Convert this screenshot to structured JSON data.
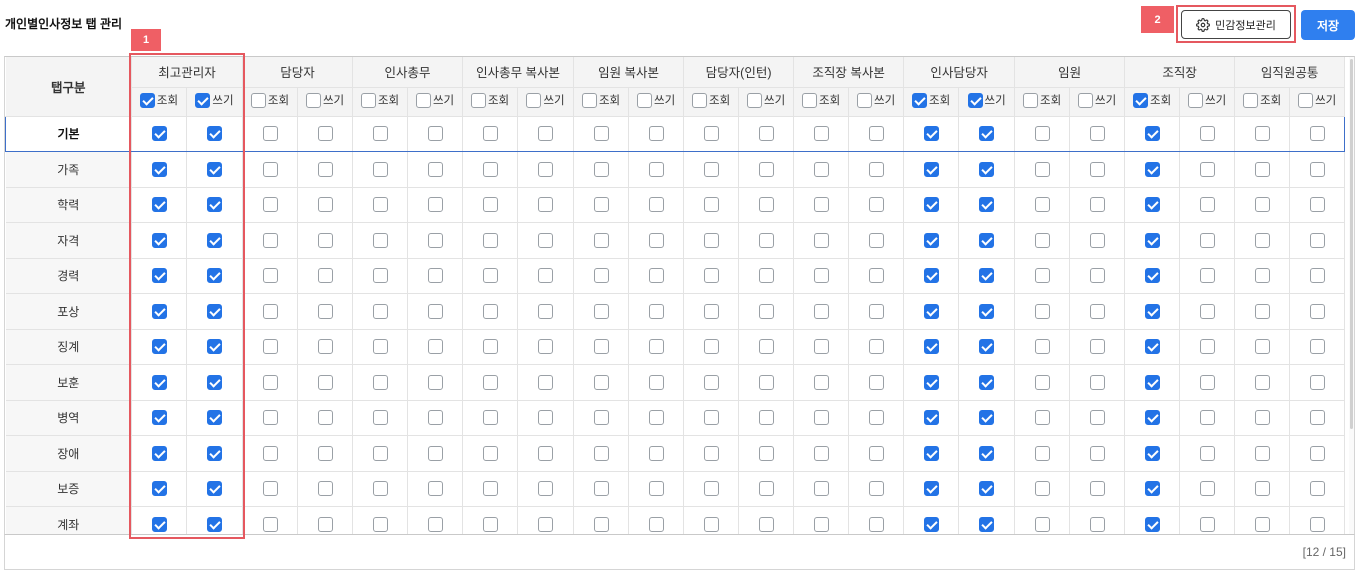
{
  "page_title": "개인별인사정보 탭 관리",
  "buttons": {
    "sensitive_label": "민감정보관리",
    "save_label": "저장"
  },
  "annotations": [
    "1",
    "2"
  ],
  "table": {
    "corner_header": "탭구분",
    "roles": [
      "최고관리자",
      "담당자",
      "인사총무",
      "인사총무 복사본",
      "임원 복사본",
      "담당자(인턴)",
      "조직장 복사본",
      "인사담당자",
      "임원",
      "조직장",
      "임직원공통"
    ],
    "sub_headers": {
      "read": "조회",
      "write": "쓰기"
    },
    "header_checks": [
      [
        true,
        true
      ],
      [
        false,
        false
      ],
      [
        false,
        false
      ],
      [
        false,
        false
      ],
      [
        false,
        false
      ],
      [
        false,
        false
      ],
      [
        false,
        false
      ],
      [
        true,
        true
      ],
      [
        false,
        false
      ],
      [
        true,
        false
      ],
      [
        false,
        false
      ]
    ],
    "rows": [
      {
        "name": "기본",
        "selected": true
      },
      {
        "name": "가족"
      },
      {
        "name": "학력"
      },
      {
        "name": "자격"
      },
      {
        "name": "경력"
      },
      {
        "name": "포상"
      },
      {
        "name": "징계"
      },
      {
        "name": "보훈"
      },
      {
        "name": "병역"
      },
      {
        "name": "장애"
      },
      {
        "name": "보증"
      },
      {
        "name": "계좌"
      }
    ],
    "row_checks": [
      [
        true,
        true
      ],
      [
        false,
        false
      ],
      [
        false,
        false
      ],
      [
        false,
        false
      ],
      [
        false,
        false
      ],
      [
        false,
        false
      ],
      [
        false,
        false
      ],
      [
        true,
        true
      ],
      [
        false,
        false
      ],
      [
        true,
        false
      ],
      [
        false,
        false
      ]
    ]
  },
  "footer": {
    "count": "[12 / 15]"
  },
  "icons": {
    "gear": "gear-icon"
  },
  "colors": {
    "accent": "#2f7fef",
    "checkbox_on": "#2373e6",
    "highlight": "#e5585f",
    "selected_row": "#3e6fc9"
  }
}
